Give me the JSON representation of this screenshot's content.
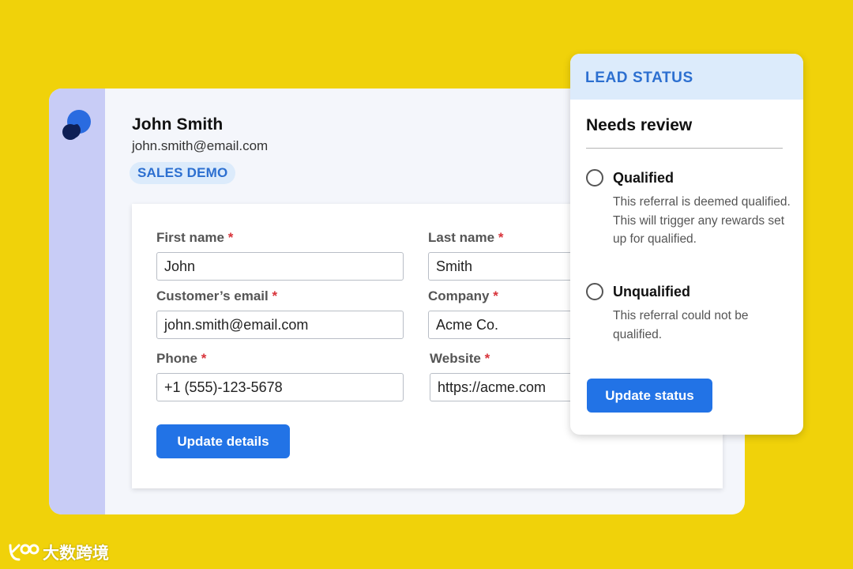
{
  "contact": {
    "name": "John Smith",
    "email": "john.smith@email.com",
    "badge": "SALES DEMO"
  },
  "form": {
    "fields": [
      {
        "label": "First name",
        "value": "John"
      },
      {
        "label": "Last name",
        "value": "Smith"
      },
      {
        "label": "Customer’s email",
        "value": "john.smith@email.com"
      },
      {
        "label": "Company",
        "value": "Acme Co."
      },
      {
        "label": "Phone",
        "value": "+1 (555)-123-5678"
      },
      {
        "label": "Website",
        "value": "https://acme.com"
      }
    ],
    "required_mark": "*",
    "submit_label": "Update details"
  },
  "lead_status": {
    "title": "LEAD STATUS",
    "current": "Needs review",
    "options": [
      {
        "label": "Qualified",
        "description": "This referral is deemed qualified. This will trigger any rewards set up for qualified."
      },
      {
        "label": "Unqualified",
        "description": "This referral could not be qualified."
      }
    ],
    "submit_label": "Update status"
  },
  "watermark": {
    "text": "大数跨境"
  },
  "colors": {
    "background": "#F0D20A",
    "sidebar": "#C8CCF6",
    "accent": "#2273E6",
    "badge_bg": "#DCEBFB",
    "badge_text": "#2C6FD0",
    "required": "#D8333A"
  },
  "icons": [
    "app-logo-icon",
    "radio-unchecked-icon",
    "watermark-logo-icon"
  ]
}
